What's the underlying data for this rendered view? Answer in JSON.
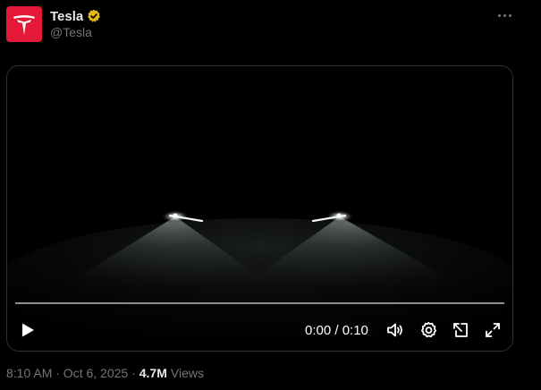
{
  "tweet": {
    "author_name": "Tesla",
    "handle": "@Tesla",
    "avatar_icon": "tesla-logo",
    "verified_icon": "verified-badge-gold",
    "more_icon": "more-dots",
    "video": {
      "time": "0:00 / 0:10",
      "progress": 0,
      "icons": [
        "play-icon",
        "volume-icon",
        "settings-icon",
        "pip-icon",
        "fullscreen-icon"
      ]
    },
    "timestamp": "8:10 AM · Oct 6, 2025 ·",
    "views_count": "4.7M",
    "views_label": "Views"
  },
  "colors": {
    "brand": "#e31937",
    "badge": "#e2b719",
    "secondary_text": "#71767b"
  }
}
